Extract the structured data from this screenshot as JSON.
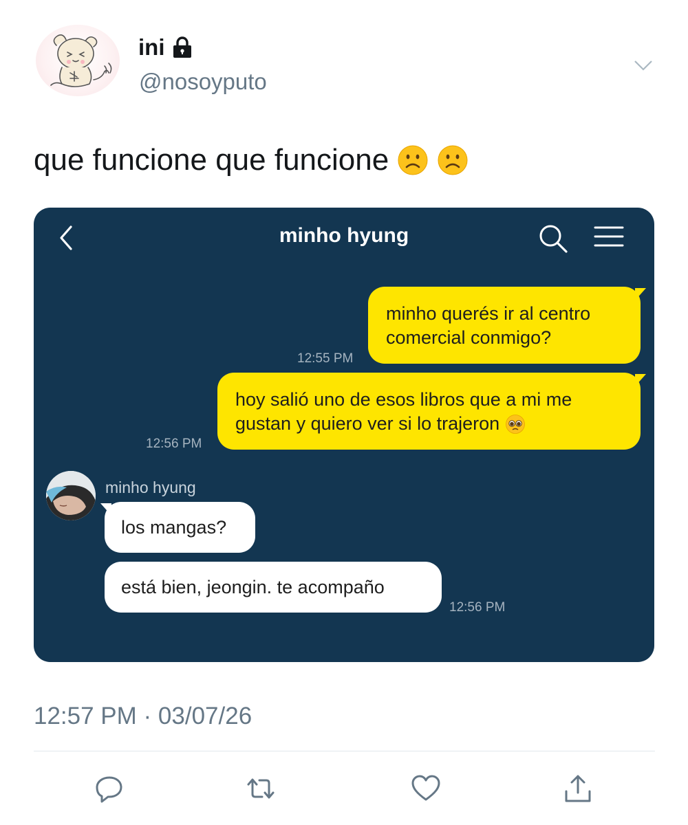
{
  "tweet": {
    "display_name": "ini",
    "handle": "@nosoyputo",
    "text": "que funcione que funcione",
    "emoji_icons": [
      "frowning-face-emoji",
      "frowning-face-emoji"
    ],
    "timestamp": "12:57 PM · 03/07/26"
  },
  "chat": {
    "title": "minho hyung",
    "messages": [
      {
        "direction": "outgoing",
        "lines": [
          "minho querés ir al centro",
          "comercial conmigo?"
        ],
        "time": "12:55 PM"
      },
      {
        "direction": "outgoing",
        "lines": [
          "hoy salió uno de esos libros que a mi me",
          "gustan y quiero ver si lo trajeron"
        ],
        "emoji": "pleading-face-emoji",
        "time": "12:56 PM"
      },
      {
        "direction": "incoming",
        "sender": "minho hyung",
        "text": "los mangas?"
      },
      {
        "direction": "incoming",
        "text": "está bien, jeongin. te acompaño",
        "time": "12:56 PM"
      }
    ]
  },
  "colors": {
    "chat_background": "#133651",
    "outgoing_bubble": "#fee500",
    "incoming_bubble": "#ffffff",
    "secondary_text": "#657786"
  },
  "actions": {
    "icons": [
      "reply-icon",
      "retweet-icon",
      "like-icon",
      "share-icon"
    ]
  }
}
